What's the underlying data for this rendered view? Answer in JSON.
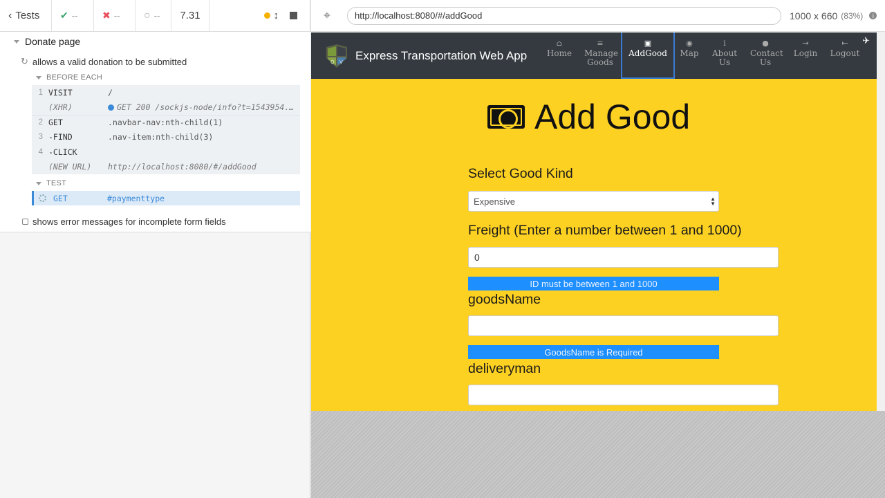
{
  "reporter": {
    "back_label": "Tests",
    "passed": "--",
    "failed": "--",
    "pending": "--",
    "duration": "7.31",
    "suite_title": "Donate page",
    "test1_title": "allows a valid donation to be submitted",
    "before_each_label": "BEFORE EACH",
    "test_label": "TEST",
    "commands": [
      {
        "num": "1",
        "name": "VISIT",
        "msg": "/"
      },
      {
        "num": "",
        "name": "(XHR)",
        "msg": "GET 200 /sockjs-node/info?t=1543954..."
      },
      {
        "num": "2",
        "name": "GET",
        "msg": ".navbar-nav:nth-child(1)"
      },
      {
        "num": "3",
        "name": "-FIND",
        "msg": ".nav-item:nth-child(3)"
      },
      {
        "num": "4",
        "name": "-CLICK",
        "msg": ""
      },
      {
        "num": "",
        "name": "(NEW URL)",
        "msg": "http://localhost:8080/#/addGood"
      }
    ],
    "active_command": {
      "name": "GET",
      "msg": "#paymenttype"
    },
    "test2_title": "shows error messages for incomplete form fields"
  },
  "browser": {
    "url": "http://localhost:8080/#/addGood",
    "viewport": "1000 x 660",
    "zoom": "(83%)"
  },
  "app": {
    "brand": "Express Transportation Web App",
    "nav": [
      {
        "icon": "home-icon",
        "glyph": "⌂",
        "label": "Home"
      },
      {
        "icon": "list-icon",
        "glyph": "≡",
        "label": "Manage Goods"
      },
      {
        "icon": "money-icon",
        "glyph": "▣",
        "label": "AddGood",
        "active": true
      },
      {
        "icon": "globe-icon",
        "glyph": "◉",
        "label": "Map"
      },
      {
        "icon": "info-icon",
        "glyph": "i",
        "label": "About Us"
      },
      {
        "icon": "comment-icon",
        "glyph": "●",
        "label": "Contact Us"
      },
      {
        "icon": "login-icon",
        "glyph": "⇥",
        "label": "Login"
      },
      {
        "icon": "logout-icon",
        "glyph": "⇤",
        "label": "Logout"
      }
    ],
    "page_title": "Add Good",
    "select_label": "Select Good Kind",
    "select_value": "Expensive",
    "freight_label": "Freight (Enter a number between 1 and 1000)",
    "freight_value": "0",
    "freight_error": "ID must be between 1 and 1000",
    "goods_label": "goodsName",
    "goods_value": "",
    "goods_error": "GoodsName is Required",
    "delivery_label": "deliveryman",
    "delivery_value": ""
  }
}
